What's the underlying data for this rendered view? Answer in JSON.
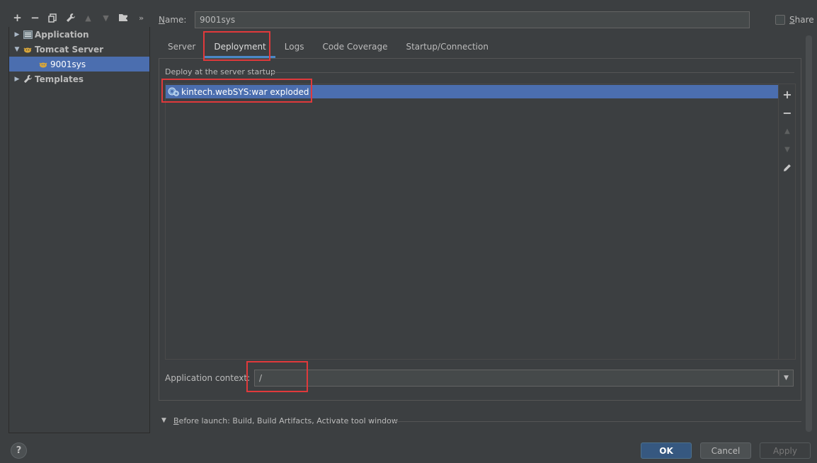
{
  "toolbar": {
    "add": "+",
    "remove": "−",
    "more": "»"
  },
  "tree": {
    "items": [
      {
        "label": "Application"
      },
      {
        "label": "Tomcat Server"
      },
      {
        "label": "9001sys"
      },
      {
        "label": "Templates"
      }
    ]
  },
  "name": {
    "label_prefix": "N",
    "label_rest": "ame:",
    "value": "9001sys"
  },
  "share": {
    "label_prefix": "S",
    "label_rest": "hare",
    "checked": false
  },
  "tabs": [
    {
      "label": "Server"
    },
    {
      "label": "Deployment",
      "active": true
    },
    {
      "label": "Logs"
    },
    {
      "label": "Code Coverage"
    },
    {
      "label": "Startup/Connection"
    }
  ],
  "deployment": {
    "section_title": "Deploy at the server startup",
    "artifacts": [
      {
        "label": "kintech.webSYS:war exploded",
        "selected": true
      }
    ],
    "side_buttons": {
      "add": "+",
      "remove": "−"
    },
    "context_label": "Application context:",
    "context_value": "/"
  },
  "before_launch": {
    "label_prefix": "B",
    "label_rest": "efore launch: Build, Build Artifacts, Activate tool window"
  },
  "footer": {
    "help": "?",
    "ok": "OK",
    "cancel": "Cancel",
    "apply": "Apply"
  },
  "colors": {
    "background": "#3c3f41",
    "selection": "#4b6eaf",
    "highlight_box": "#e0393b",
    "ok_button": "#365880"
  }
}
